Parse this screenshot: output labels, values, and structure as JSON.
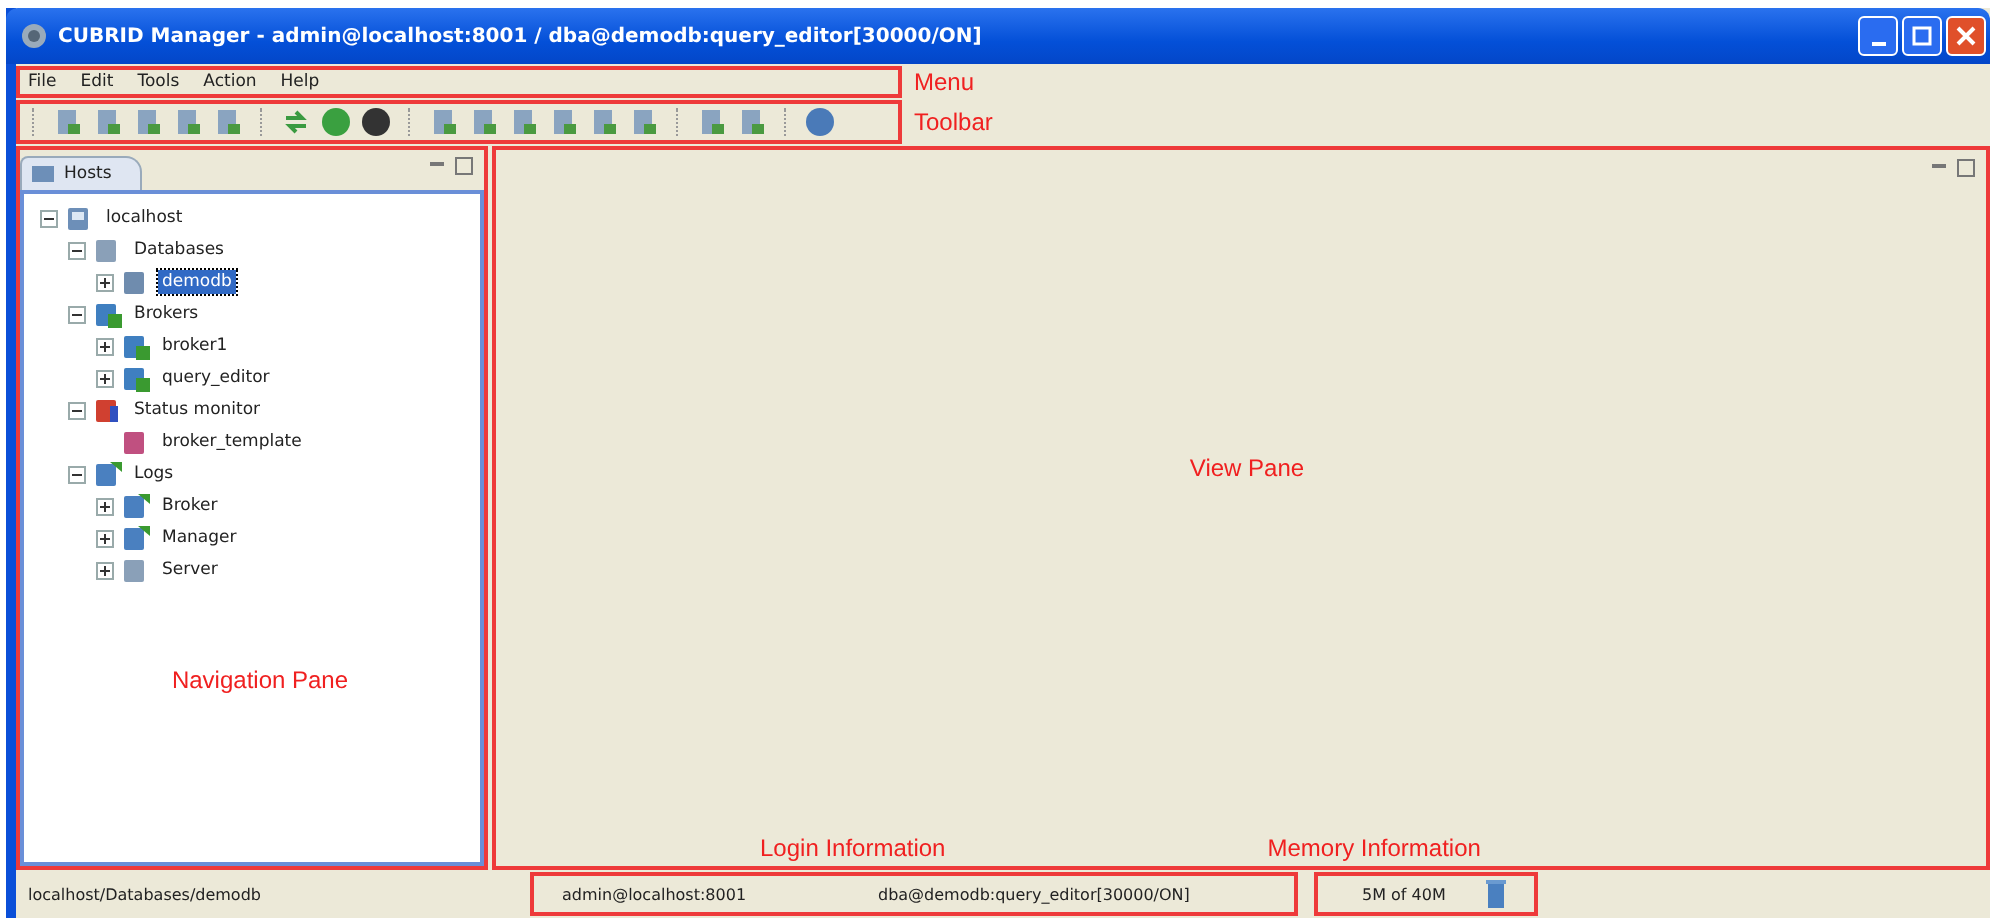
{
  "window": {
    "title": "CUBRID Manager - admin@localhost:8001 / dba@demodb:query_editor[30000/ON]"
  },
  "menu": {
    "items": [
      "File",
      "Edit",
      "Tools",
      "Action",
      "Help"
    ],
    "annotation": "Menu"
  },
  "toolbar": {
    "annotation": "Toolbar"
  },
  "navigation_pane": {
    "tab": "Hosts",
    "annotation": "Navigation Pane",
    "tree": [
      {
        "label": "localhost",
        "kind": "host",
        "expanded": true,
        "selected": false,
        "children": [
          {
            "label": "Databases",
            "kind": "folder",
            "expanded": true,
            "selected": false,
            "children": [
              {
                "label": "demodb",
                "kind": "database",
                "expanded": false,
                "selected": true
              }
            ]
          },
          {
            "label": "Brokers",
            "kind": "broker",
            "expanded": true,
            "selected": false,
            "children": [
              {
                "label": "broker1",
                "kind": "broker",
                "expanded": false,
                "selected": false
              },
              {
                "label": "query_editor",
                "kind": "broker",
                "expanded": false,
                "selected": false
              }
            ]
          },
          {
            "label": "Status monitor",
            "kind": "monitor",
            "expanded": true,
            "selected": false,
            "children": [
              {
                "label": "broker_template",
                "kind": "chart",
                "selected": false
              }
            ]
          },
          {
            "label": "Logs",
            "kind": "logs",
            "expanded": true,
            "selected": false,
            "children": [
              {
                "label": "Broker",
                "kind": "logs",
                "expanded": false,
                "selected": false
              },
              {
                "label": "Manager",
                "kind": "logs",
                "expanded": false,
                "selected": false
              },
              {
                "label": "Server",
                "kind": "folder",
                "expanded": false,
                "selected": false
              }
            ]
          }
        ]
      }
    ]
  },
  "view_pane": {
    "annotation": "View Pane",
    "login_annotation": "Login Information",
    "memory_annotation": "Memory Information"
  },
  "status_bar": {
    "path": "localhost/Databases/demodb",
    "login": "admin@localhost:8001",
    "connection": "dba@demodb:query_editor[30000/ON]",
    "memory": "5M of 40M"
  }
}
